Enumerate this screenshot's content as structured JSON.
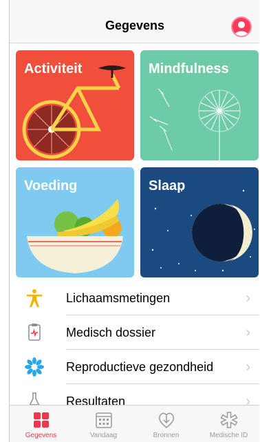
{
  "navbar": {
    "title": "Gegevens"
  },
  "tiles": [
    {
      "label": "Activiteit",
      "color": "#f14f3b"
    },
    {
      "label": "Mindfulness",
      "color": "#6ecba7"
    },
    {
      "label": "Voeding",
      "color": "#7fcbef"
    },
    {
      "label": "Slaap",
      "color": "#1b4a80"
    }
  ],
  "list": [
    {
      "label": "Lichaamsmetingen",
      "icon": "body-figure-icon"
    },
    {
      "label": "Medisch dossier",
      "icon": "clipboard-heart-icon"
    },
    {
      "label": "Reproductieve gezondheid",
      "icon": "flower-icon"
    },
    {
      "label": "Resultaten",
      "icon": "flask-icon"
    }
  ],
  "tabbar": {
    "tabs": [
      {
        "label": "Gegevens",
        "active": true
      },
      {
        "label": "Vandaag",
        "active": false
      },
      {
        "label": "Bronnen",
        "active": false
      },
      {
        "label": "Medische ID",
        "active": false
      }
    ],
    "accent": "#f1384b"
  }
}
